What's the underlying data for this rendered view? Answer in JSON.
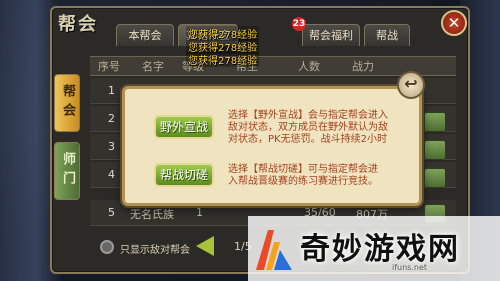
{
  "panel": {
    "title": "帮会"
  },
  "tabs": [
    {
      "label": "本帮会"
    },
    {
      "label": "其他帮会"
    },
    {
      "label": "帮会福利"
    },
    {
      "label": "帮战"
    }
  ],
  "badge": {
    "count": "23"
  },
  "close_icon": "close-x-icon",
  "side_tabs": [
    {
      "label": "帮会"
    },
    {
      "label": "师门"
    }
  ],
  "table": {
    "headers": [
      "序号",
      "名字",
      "等级",
      "帮主",
      "人数",
      "战力"
    ],
    "row_numbers": [
      "1",
      "2",
      "3",
      "4",
      "5"
    ],
    "row5": {
      "name": "无名氏族",
      "level": "1",
      "members": "35/60",
      "power": "807万"
    }
  },
  "footer": {
    "checkbox_label": "只显示敌对帮会",
    "page": "1/5"
  },
  "dialog": {
    "back_icon": "return-arrow-icon",
    "btn1": "野外宣战",
    "desc1": [
      "选择【野外宣战】会与指定帮会进入",
      "敌对状态，双方成员在野外默认为敌",
      "对状态，PK无惩罚。战斗持续2小时"
    ],
    "btn2": "帮战切磋",
    "desc2": [
      "选择【帮战切磋】可与指定帮会进",
      "入帮战晋级赛的练习赛进行竞技。"
    ]
  },
  "notifications": [
    "您获得278经验",
    "您获得278经验",
    "您获得278经验"
  ],
  "watermark": {
    "text": "奇妙游戏网",
    "url": "ifuns.net"
  },
  "colors": {
    "accent_green": "#7ea35a",
    "gold_tab": "#f1c45a",
    "xp_yellow": "#ffd43b",
    "close_red": "#c8442a"
  }
}
